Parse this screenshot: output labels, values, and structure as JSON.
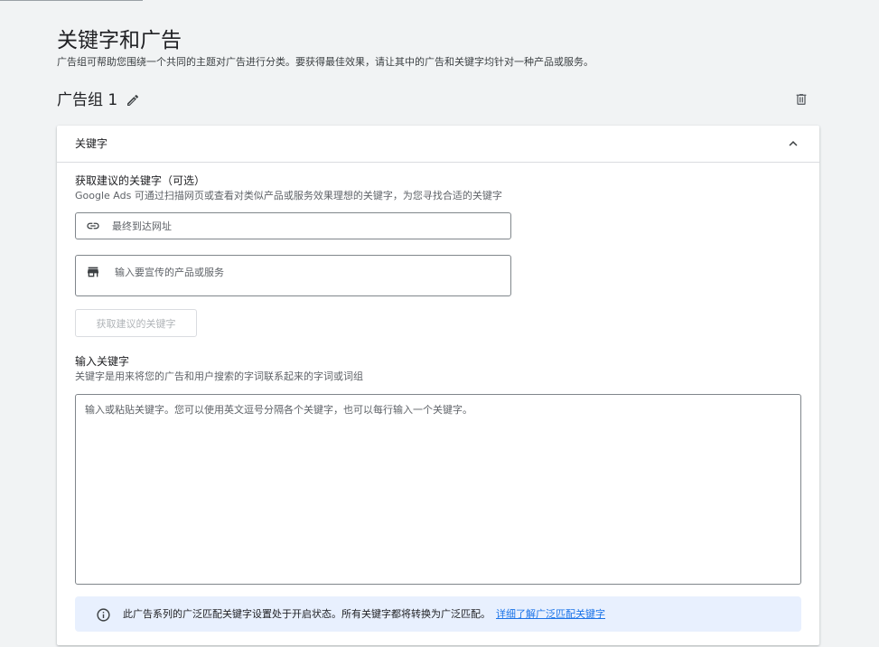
{
  "page": {
    "title": "关键字和广告",
    "subtitle": "广告组可帮助您围绕一个共同的主题对广告进行分类。要获得最佳效果，请让其中的广告和关键字均针对一种产品或服务。"
  },
  "ad_group": {
    "title": "广告组 1",
    "edit_icon": "pencil-icon",
    "delete_icon": "trash-icon"
  },
  "keywords_card": {
    "header_title": "关键字",
    "collapse_icon": "chevron-up-icon",
    "suggest_section": {
      "title": "获取建议的关键字（可选）",
      "description": "Google Ads 可通过扫描网页或查看对类似产品或服务效果理想的关键字，为您寻找合适的关键字",
      "url_field": {
        "icon": "link-icon",
        "placeholder": "最终到达网址",
        "value": ""
      },
      "product_field": {
        "icon": "store-icon",
        "placeholder": "输入要宣传的产品或服务",
        "value": ""
      },
      "button_label": "获取建议的关键字"
    },
    "enter_section": {
      "title": "输入关键字",
      "description": "关键字是用来将您的广告和用户搜索的字词联系起来的字词或词组",
      "textarea_placeholder": "输入或粘贴关键字。您可以使用英文逗号分隔各个关键字，也可以每行输入一个关键字。",
      "textarea_value": ""
    },
    "info_banner": {
      "icon": "info-icon",
      "text": "此广告系列的广泛匹配关键字设置处于开启状态。所有关键字都将转换为广泛匹配。",
      "link_label": "详细了解广泛匹配关键字"
    }
  },
  "colors": {
    "background": "#f1f3f4",
    "card": "#ffffff",
    "link": "#1a73e8",
    "banner": "#e8f0fe"
  }
}
